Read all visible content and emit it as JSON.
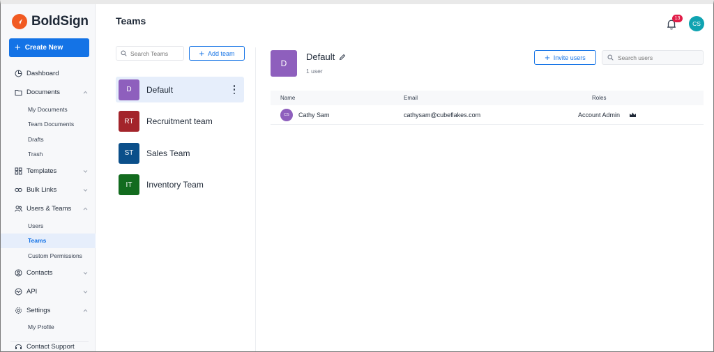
{
  "app": {
    "logo_text": "BoldSign",
    "brand_color": "#f15a22",
    "accent_color": "#1473e6"
  },
  "sidebar": {
    "create_label": "Create New",
    "dashboard": "Dashboard",
    "documents": {
      "label": "Documents",
      "children": [
        "My Documents",
        "Team Documents",
        "Drafts",
        "Trash"
      ]
    },
    "templates": "Templates",
    "bulk_links": "Bulk Links",
    "users_teams": {
      "label": "Users & Teams",
      "children": [
        "Users",
        "Teams",
        "Custom Permissions"
      ],
      "active": "Teams"
    },
    "contacts": "Contacts",
    "api": "API",
    "settings": {
      "label": "Settings",
      "children": [
        "My Profile"
      ]
    },
    "contact_support": "Contact Support"
  },
  "header": {
    "title": "Teams",
    "notification_count": "13",
    "user_initials": "CS"
  },
  "teams_panel": {
    "search_placeholder": "Search Teams",
    "add_team_label": "Add team",
    "teams": [
      {
        "initials": "D",
        "name": "Default",
        "color": "#8e5fbd",
        "selected": true
      },
      {
        "initials": "RT",
        "name": "Recruitment team",
        "color": "#a3242b"
      },
      {
        "initials": "ST",
        "name": "Sales Team",
        "color": "#0b4f8a"
      },
      {
        "initials": "IT",
        "name": "Inventory Team",
        "color": "#126b1e"
      }
    ]
  },
  "detail": {
    "initials": "D",
    "name": "Default",
    "user_count": "1 user",
    "invite_label": "Invite users",
    "search_placeholder": "Search users",
    "columns": [
      "Name",
      "Email",
      "Roles"
    ],
    "users": [
      {
        "initials": "CS",
        "name": "Cathy Sam",
        "email": "cathysam@cubeflakes.com",
        "role": "Account Admin"
      }
    ]
  }
}
